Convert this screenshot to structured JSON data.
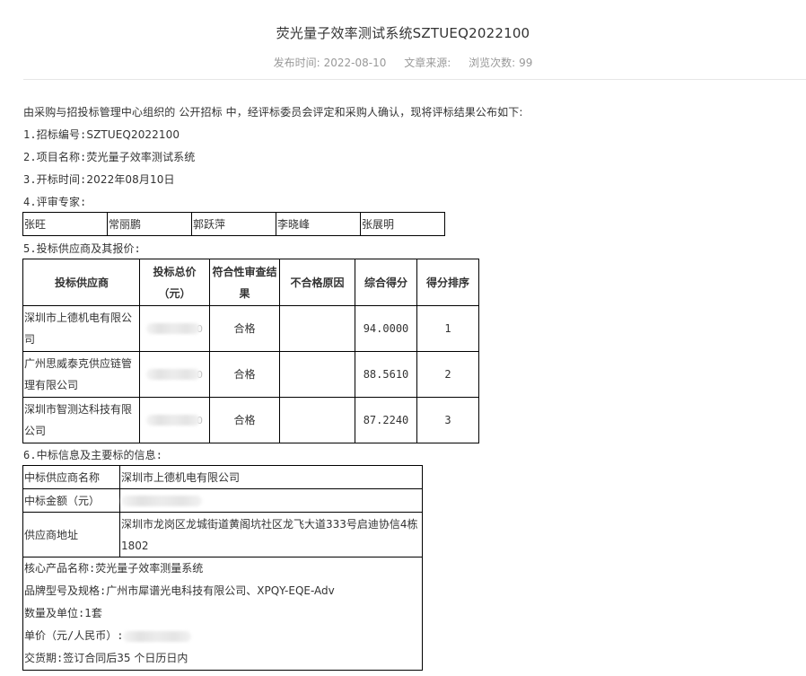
{
  "header": {
    "title": "荧光量子效率测试系统SZTUEQ2022100",
    "publish_label": "发布时间:",
    "publish_date": "2022-08-10",
    "source_label": "文章来源:",
    "views_label": "浏览次数:",
    "views_count": "99"
  },
  "intro": "由采购与招投标管理中心组织的 公开招标 中，经评标委员会评定和采购人确认，现将评标结果公布如下:",
  "items": {
    "bid_no_label": "1.招标编号:",
    "bid_no": "SZTUEQ2022100",
    "project_label": "2.项目名称:",
    "project": "荧光量子效率测试系统",
    "open_time_label": "3.开标时间:",
    "open_time": "2022年08月10日",
    "experts_label": "4.评审专家:",
    "bidders_label": "5.投标供应商及其报价:",
    "winner_label": "6.中标信息及主要标的信息:"
  },
  "experts": [
    "张旺",
    "常丽鹏",
    "郭跃萍",
    "李晓峰",
    "张展明"
  ],
  "bid_table": {
    "headers": [
      "投标供应商",
      "投标总价（元）",
      "符合性审查结 果",
      "不合格原因",
      "综合得分",
      "得分排序"
    ],
    "rows": [
      {
        "supplier": "深圳市上德机电有限公司",
        "price_tail": "0",
        "review": "合格",
        "reason": "",
        "score": "94.0000",
        "rank": "1"
      },
      {
        "supplier": "广州思威泰克供应链管理有限公司",
        "price_tail": "0",
        "review": "合格",
        "reason": "",
        "score": "88.5610",
        "rank": "2"
      },
      {
        "supplier": "深圳市智测达科技有限公司",
        "price_tail": "0",
        "review": "合格",
        "reason": "",
        "score": "87.2240",
        "rank": "3"
      }
    ]
  },
  "winner": {
    "name_label": "中标供应商名称",
    "name": "深圳市上德机电有限公司",
    "amount_label": "中标金额（元）",
    "address_label": "供应商地址",
    "address": "深圳市龙岗区龙城街道黄阁坑社区龙飞大道333号启迪协信4栋1802",
    "product_label": "核心产品名称:",
    "product": "荧光量子效率测量系统",
    "brand_label": "品牌型号及规格:",
    "brand": "广州市犀谱光电科技有限公司、XPQY-EQE-Adv",
    "qty_label": "数量及单位:",
    "qty": "1套",
    "unit_price_label": "单价（元/人民币）:",
    "delivery_label": "交货期:",
    "delivery": "签订合同后35 个日历日内"
  }
}
